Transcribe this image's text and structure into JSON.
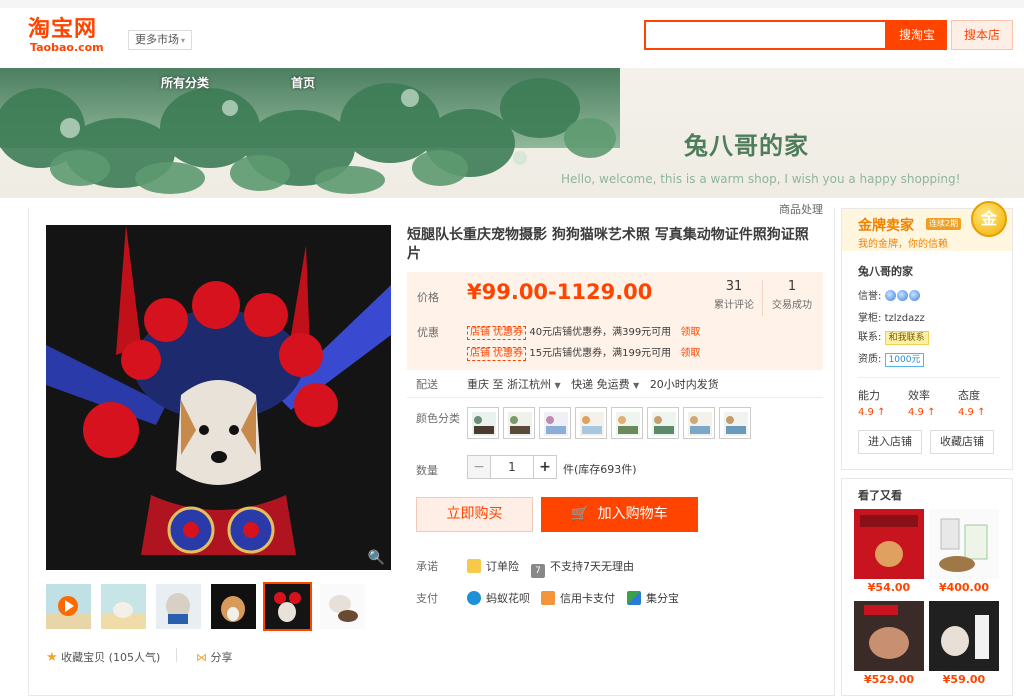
{
  "header": {
    "logo_cn": "淘宝网",
    "logo_en": "Taobao.com",
    "market": "更多市场",
    "search_placeholder": "",
    "search_taobao": "搜淘宝",
    "search_store": "搜本店"
  },
  "banner": {
    "nav": [
      "所有分类",
      "首页"
    ],
    "shop_name": "兔八哥的家",
    "slogan": "Hello, welcome, this is a warm shop, I wish you a happy shopping!"
  },
  "product": {
    "process_link": "商品处理",
    "title": "短腿队长重庆宠物摄影 狗狗猫咪艺术照 写真集动物证件照狗证照片",
    "price_label": "价格",
    "price": "¥99.00-1129.00",
    "reviews_count": "31",
    "reviews_label": "累计评论",
    "sales_count": "1",
    "sales_label": "交易成功",
    "promo_label": "优惠",
    "promos": [
      {
        "tag": "店铺 优惠券",
        "text": "40元店铺优惠券，满399元可用",
        "action": "领取"
      },
      {
        "tag": "店铺 优惠券",
        "text": "15元店铺优惠券，满199元可用",
        "action": "领取"
      }
    ],
    "delivery_label": "配送",
    "delivery": {
      "from": "重庆 至",
      "to": "浙江杭州",
      "method": "快递 免运费",
      "time": "20小时内发货"
    },
    "color_label": "颜色分类",
    "qty_label": "数量",
    "qty": "1",
    "stock": "件(库存693件)",
    "buy_now": "立即购买",
    "add_cart": "加入购物车",
    "promise_label": "承诺",
    "promises": [
      "订单险",
      "不支持7天无理由"
    ],
    "pay_label": "支付",
    "payments": [
      "蚂蚁花呗",
      "信用卡支付",
      "集分宝"
    ],
    "favorite": "收藏宝贝 (105人气)",
    "share": "分享"
  },
  "seller": {
    "gold_title": "金牌卖家",
    "gold_badge": "连续2期",
    "gold_sub": "我的金牌，你的信赖",
    "medal": "金",
    "name": "兔八哥的家",
    "credit_label": "信誉:",
    "keeper_label": "掌柜:",
    "keeper": "tzlzdazz",
    "contact_label": "联系:",
    "contact": "和我联系",
    "qual_label": "资质:",
    "bond": "1000元",
    "scores": [
      {
        "label": "能力",
        "value": "4.9 ↑"
      },
      {
        "label": "效率",
        "value": "4.9 ↑"
      },
      {
        "label": "态度",
        "value": "4.9 ↑"
      }
    ],
    "enter_store": "进入店铺",
    "fav_store": "收藏店铺"
  },
  "also_viewed": {
    "title": "看了又看",
    "items": [
      {
        "price": "¥54.00"
      },
      {
        "price": "¥400.00"
      },
      {
        "price": "¥529.00"
      },
      {
        "price": "¥59.00"
      }
    ]
  },
  "colors": {
    "accent": "#ff4400",
    "gold": "#f08200",
    "shop_green": "#4f7d5c"
  }
}
